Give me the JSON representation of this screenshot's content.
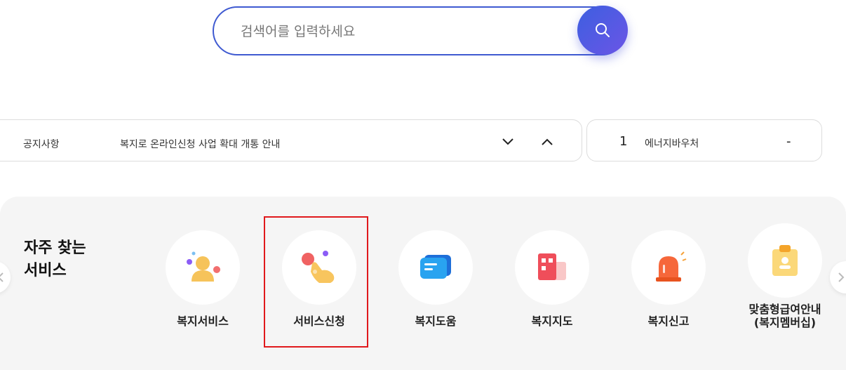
{
  "search": {
    "placeholder": "검색어를 입력하세요"
  },
  "notice": {
    "label": "공지사항",
    "text": "복지로 온라인신청 사업 확대 개통 안내"
  },
  "ranking": {
    "rank": "1",
    "keyword": "에너지바우처",
    "change": "-"
  },
  "services": {
    "title_line1": "자주 찾는",
    "title_line2": "서비스",
    "items": [
      {
        "label": "복지서비스",
        "icon": "person-bubbles-icon"
      },
      {
        "label": "서비스신청",
        "icon": "hand-pointer-icon"
      },
      {
        "label": "복지도움",
        "icon": "chat-card-icon"
      },
      {
        "label": "복지지도",
        "icon": "building-icon"
      },
      {
        "label": "복지신고",
        "icon": "alarm-siren-icon"
      },
      {
        "label_line1": "맞춤형급여안내",
        "label_line2": "(복지멤버십)",
        "icon": "clipboard-lock-icon"
      }
    ]
  },
  "colors": {
    "search_border": "#3f5ad1",
    "search_button": "#4b5be2",
    "panel_bg": "#f5f5f5",
    "highlight": "#e0191c"
  }
}
